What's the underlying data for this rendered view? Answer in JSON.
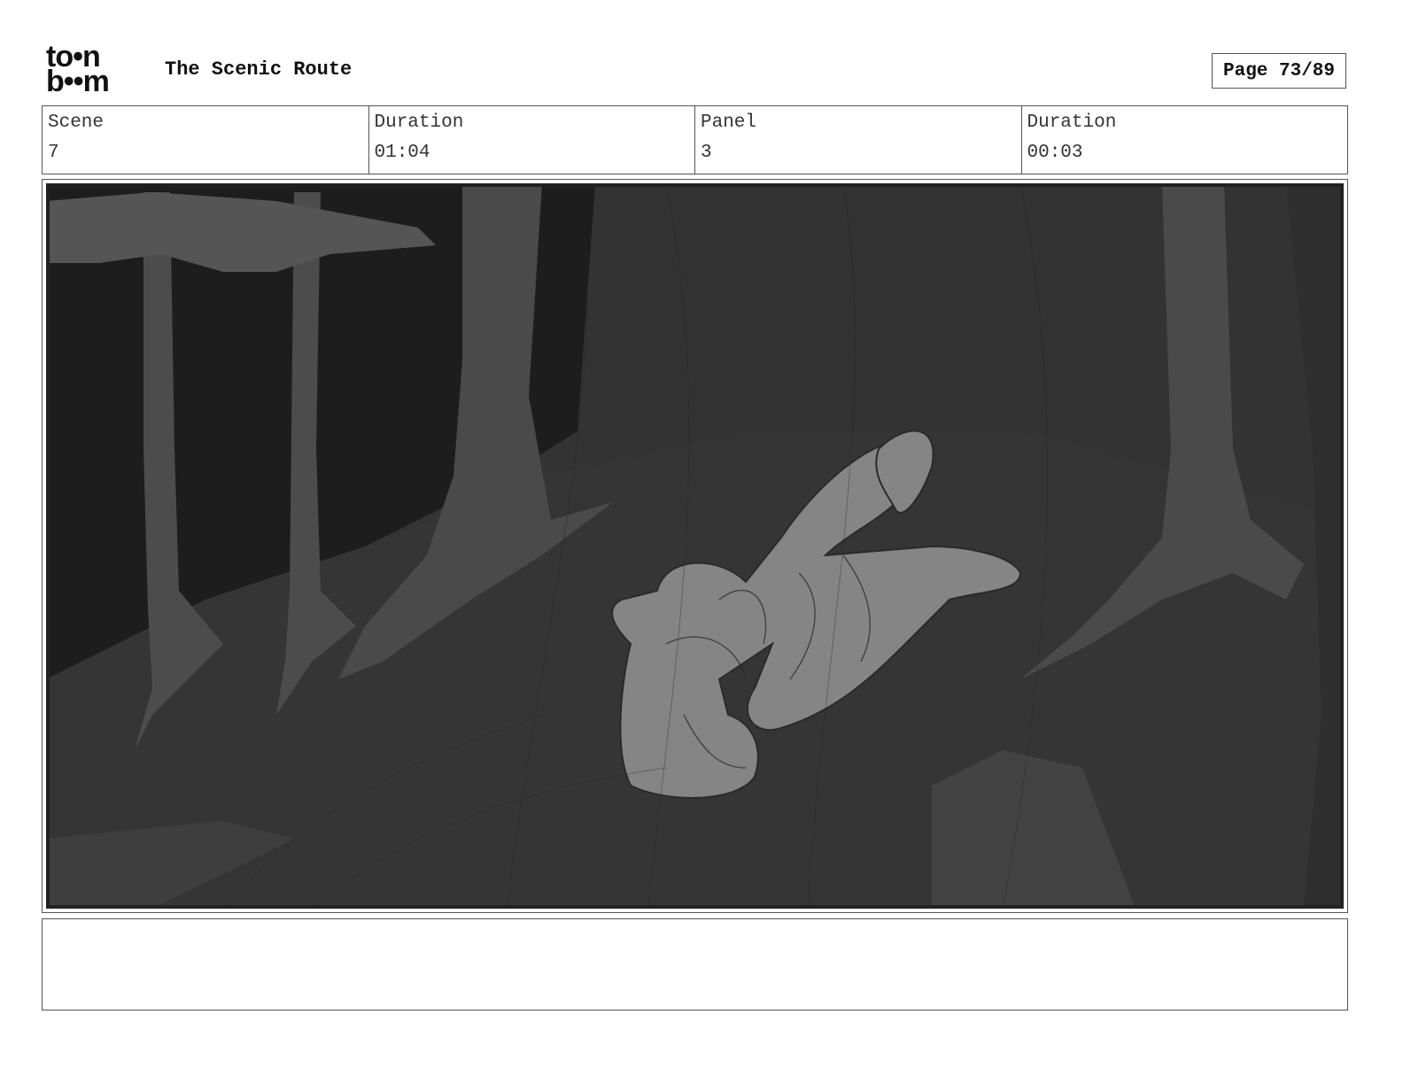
{
  "header": {
    "logo_line1": "to•n",
    "logo_line2": "b••m",
    "title": "The Scenic Route",
    "page": "Page 73/89"
  },
  "info": {
    "scene_label": "Scene",
    "scene_value": "7",
    "scene_duration_label": "Duration",
    "scene_duration_value": "01:04",
    "panel_label": "Panel",
    "panel_value": "3",
    "panel_duration_label": "Duration",
    "panel_duration_value": "00:03"
  },
  "notes": {
    "text": ""
  }
}
